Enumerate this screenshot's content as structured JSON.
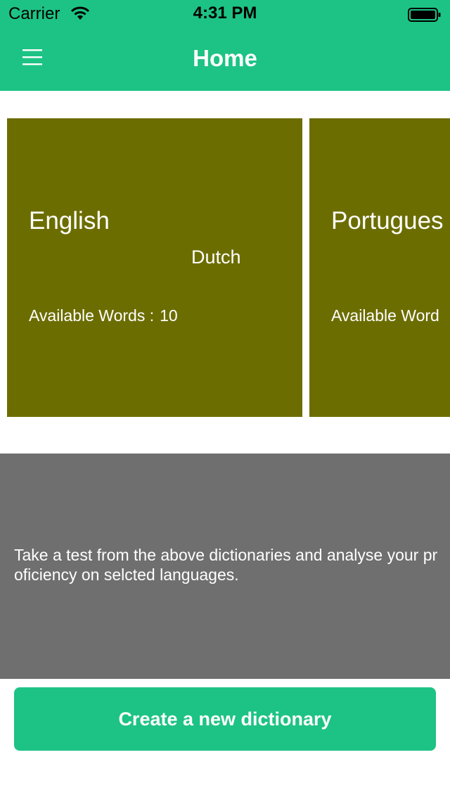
{
  "status_bar": {
    "carrier": "Carrier",
    "time": "4:31 PM",
    "wifi_icon": "wifi-icon",
    "battery_icon": "battery-icon"
  },
  "nav": {
    "title": "Home",
    "menu_icon": "hamburger-menu-icon"
  },
  "dictionaries": [
    {
      "source_language": "English",
      "target_language": "Dutch",
      "available_label": "Available Words :",
      "available_count": "10"
    },
    {
      "source_language": "Portugues",
      "available_label": "Available Word"
    }
  ],
  "info": {
    "text": "Take a test from the above dictionaries and analyse your proficiency on selcted languages."
  },
  "actions": {
    "create_label": "Create a new dictionary"
  },
  "colors": {
    "accent": "#1dc384",
    "card_background": "#6c6d00",
    "info_background": "#6f6f6f"
  }
}
